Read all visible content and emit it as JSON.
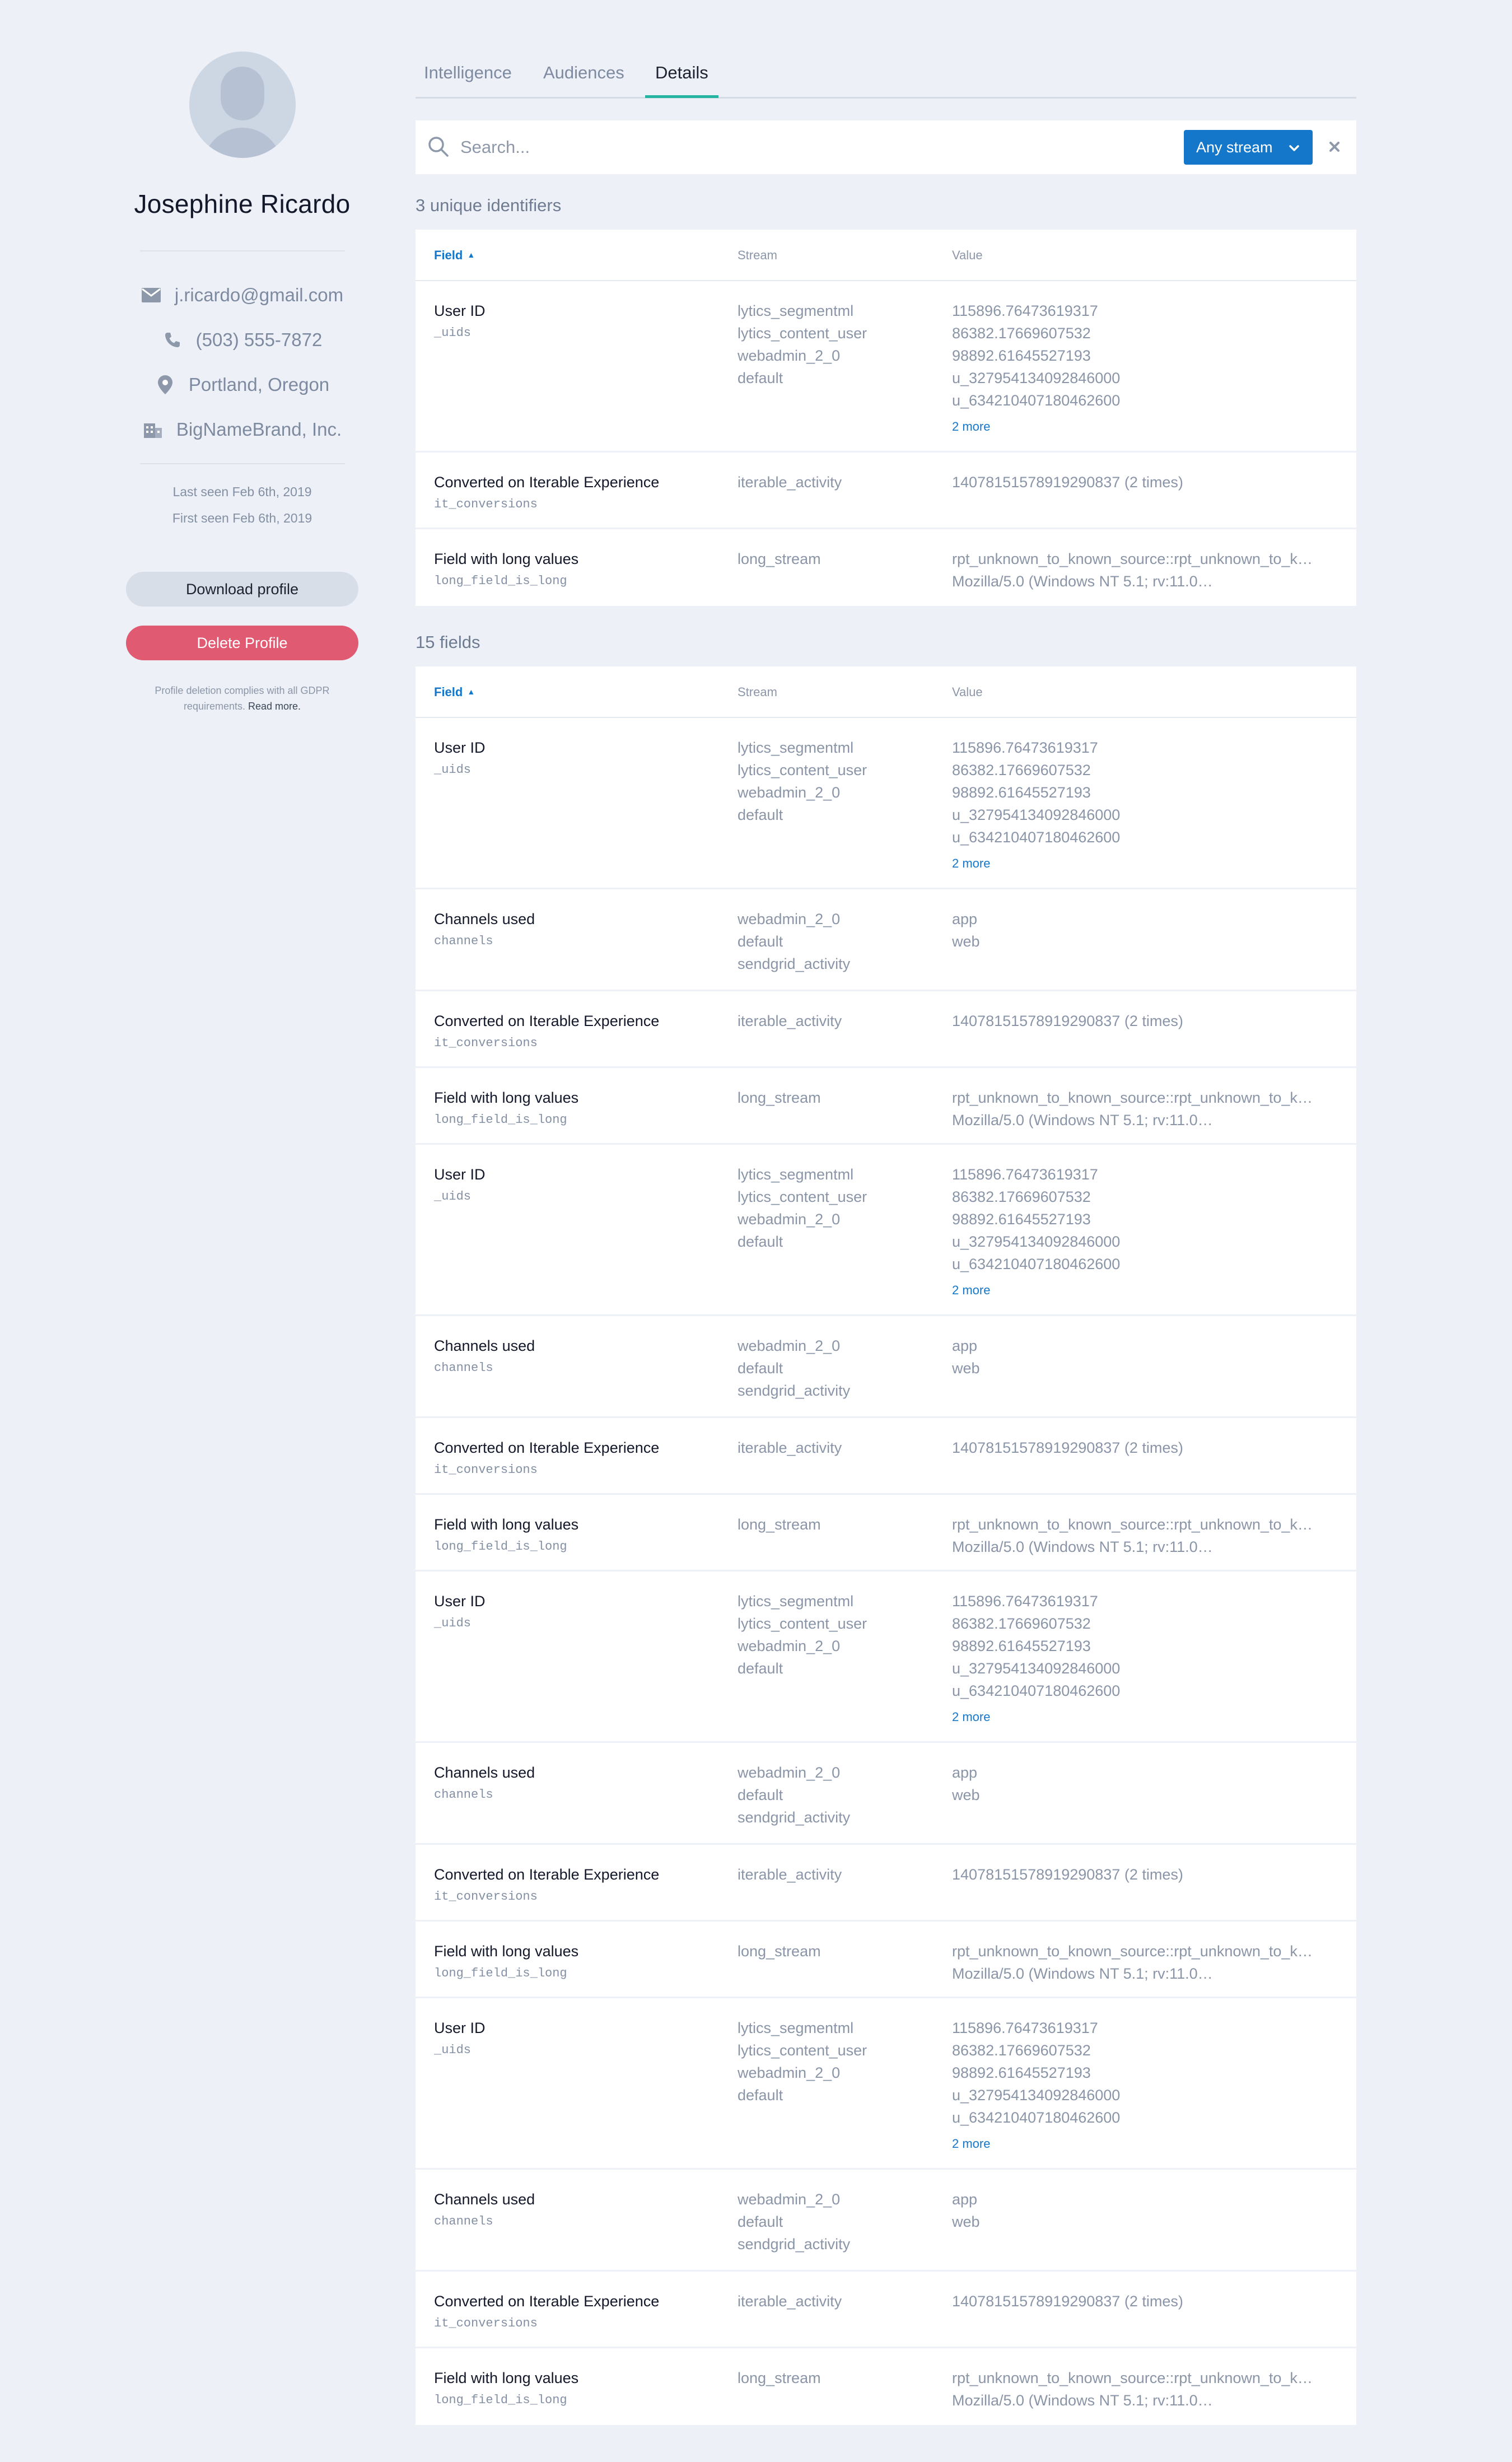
{
  "profile": {
    "name": "Josephine Ricardo",
    "email": "j.ricardo@gmail.com",
    "phone": "(503) 555-7872",
    "location": "Portland, Oregon",
    "company": "BigNameBrand, Inc.",
    "last_seen": "Last seen Feb 6th, 2019",
    "first_seen": "First seen Feb 6th, 2019"
  },
  "actions": {
    "download_label": "Download profile",
    "delete_label": "Delete Profile",
    "gdpr_text": "Profile deletion complies with all GDPR requirements.",
    "gdpr_link": "Read more."
  },
  "tabs": [
    {
      "label": "Intelligence"
    },
    {
      "label": "Audiences"
    },
    {
      "label": "Details"
    }
  ],
  "search": {
    "placeholder": "Search...",
    "stream_filter": "Any stream"
  },
  "identifiers": {
    "heading": "3 unique identifiers",
    "columns": {
      "field": "Field",
      "stream": "Stream",
      "value": "Value"
    },
    "rows": [
      {
        "name": "User ID",
        "key": "_uids",
        "streams": [
          "lytics_segmentml",
          "lytics_content_user",
          "webadmin_2_0",
          "default"
        ],
        "values": [
          "115896.76473619317",
          "86382.17669607532",
          "98892.61645527193",
          "u_327954134092846000",
          "u_634210407180462600"
        ],
        "more": "2 more"
      },
      {
        "name": "Converted on Iterable Experience",
        "key": "it_conversions",
        "streams": [
          "iterable_activity"
        ],
        "values": [
          "14078151578919290837 (2 times)"
        ]
      },
      {
        "name": "Field with long values",
        "key": "long_field_is_long",
        "streams": [
          "long_stream"
        ],
        "values": [
          "rpt_unknown_to_known_source::rpt_unknown_to_k…",
          "Mozilla/5.0 (Windows NT 5.1; rv:11.0…"
        ]
      }
    ]
  },
  "fields": {
    "heading": "15 fields",
    "columns": {
      "field": "Field",
      "stream": "Stream",
      "value": "Value"
    },
    "rows": [
      {
        "name": "User ID",
        "key": "_uids",
        "streams": [
          "lytics_segmentml",
          "lytics_content_user",
          "webadmin_2_0",
          "default"
        ],
        "values": [
          "115896.76473619317",
          "86382.17669607532",
          "98892.61645527193",
          "u_327954134092846000",
          "u_634210407180462600"
        ],
        "more": "2 more"
      },
      {
        "name": "Channels used",
        "key": "channels",
        "streams": [
          "webadmin_2_0",
          "default",
          "sendgrid_activity"
        ],
        "values": [
          "app",
          "web"
        ]
      },
      {
        "name": "Converted on Iterable Experience",
        "key": "it_conversions",
        "streams": [
          "iterable_activity"
        ],
        "values": [
          "14078151578919290837 (2 times)"
        ]
      },
      {
        "name": "Field with long values",
        "key": "long_field_is_long",
        "streams": [
          "long_stream"
        ],
        "values": [
          "rpt_unknown_to_known_source::rpt_unknown_to_k…",
          "Mozilla/5.0 (Windows NT 5.1; rv:11.0…"
        ]
      },
      {
        "name": "User ID",
        "key": "_uids",
        "streams": [
          "lytics_segmentml",
          "lytics_content_user",
          "webadmin_2_0",
          "default"
        ],
        "values": [
          "115896.76473619317",
          "86382.17669607532",
          "98892.61645527193",
          "u_327954134092846000",
          "u_634210407180462600"
        ],
        "more": "2 more"
      },
      {
        "name": "Channels used",
        "key": "channels",
        "streams": [
          "webadmin_2_0",
          "default",
          "sendgrid_activity"
        ],
        "values": [
          "app",
          "web"
        ]
      },
      {
        "name": "Converted on Iterable Experience",
        "key": "it_conversions",
        "streams": [
          "iterable_activity"
        ],
        "values": [
          "14078151578919290837 (2 times)"
        ]
      },
      {
        "name": "Field with long values",
        "key": "long_field_is_long",
        "streams": [
          "long_stream"
        ],
        "values": [
          "rpt_unknown_to_known_source::rpt_unknown_to_k…",
          "Mozilla/5.0 (Windows NT 5.1; rv:11.0…"
        ]
      },
      {
        "name": "User ID",
        "key": "_uids",
        "streams": [
          "lytics_segmentml",
          "lytics_content_user",
          "webadmin_2_0",
          "default"
        ],
        "values": [
          "115896.76473619317",
          "86382.17669607532",
          "98892.61645527193",
          "u_327954134092846000",
          "u_634210407180462600"
        ],
        "more": "2 more"
      },
      {
        "name": "Channels used",
        "key": "channels",
        "streams": [
          "webadmin_2_0",
          "default",
          "sendgrid_activity"
        ],
        "values": [
          "app",
          "web"
        ]
      },
      {
        "name": "Converted on Iterable Experience",
        "key": "it_conversions",
        "streams": [
          "iterable_activity"
        ],
        "values": [
          "14078151578919290837 (2 times)"
        ]
      },
      {
        "name": "Field with long values",
        "key": "long_field_is_long",
        "streams": [
          "long_stream"
        ],
        "values": [
          "rpt_unknown_to_known_source::rpt_unknown_to_k…",
          "Mozilla/5.0 (Windows NT 5.1; rv:11.0…"
        ]
      },
      {
        "name": "User ID",
        "key": "_uids",
        "streams": [
          "lytics_segmentml",
          "lytics_content_user",
          "webadmin_2_0",
          "default"
        ],
        "values": [
          "115896.76473619317",
          "86382.17669607532",
          "98892.61645527193",
          "u_327954134092846000",
          "u_634210407180462600"
        ],
        "more": "2 more"
      },
      {
        "name": "Channels used",
        "key": "channels",
        "streams": [
          "webadmin_2_0",
          "default",
          "sendgrid_activity"
        ],
        "values": [
          "app",
          "web"
        ]
      },
      {
        "name": "Converted on Iterable Experience",
        "key": "it_conversions",
        "streams": [
          "iterable_activity"
        ],
        "values": [
          "14078151578919290837 (2 times)"
        ]
      },
      {
        "name": "Field with long values",
        "key": "long_field_is_long",
        "streams": [
          "long_stream"
        ],
        "values": [
          "rpt_unknown_to_known_source::rpt_unknown_to_k…",
          "Mozilla/5.0 (Windows NT 5.1; rv:11.0…"
        ]
      }
    ]
  },
  "colors": {
    "accent": "#1477c9",
    "tab_indicator": "#25b3a2",
    "danger": "#e05a72",
    "background": "#edf0f7"
  }
}
